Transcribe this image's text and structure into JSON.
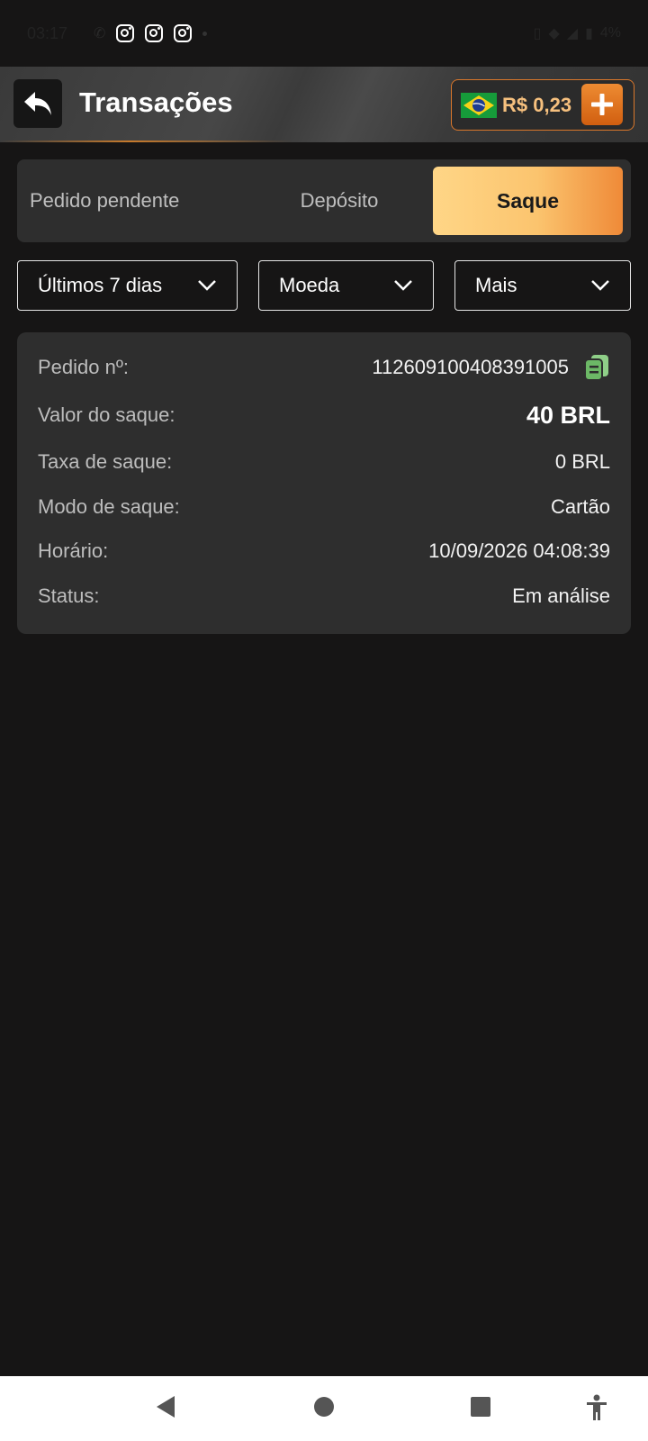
{
  "status_bar": {
    "time": "03:17",
    "battery": "4%"
  },
  "header": {
    "title": "Transações",
    "balance": "R$ 0,23"
  },
  "tabs": [
    {
      "label": "Pedido pendente",
      "active": false
    },
    {
      "label": "Depósito",
      "active": false
    },
    {
      "label": "Saque",
      "active": true
    }
  ],
  "filters": {
    "period": "Últimos 7 dias",
    "currency": "Moeda",
    "more": "Mais"
  },
  "transaction": {
    "order_label": "Pedido nº:",
    "order_value": "112609100408391005",
    "amount_label": "Valor do saque:",
    "amount_value": "40 BRL",
    "fee_label": "Taxa de saque:",
    "fee_value": "0 BRL",
    "mode_label": "Modo de saque:",
    "mode_value": "Cartão",
    "time_label": "Horário:",
    "time_value": "10/09/2026 04:08:39",
    "status_label": "Status:",
    "status_value": "Em análise"
  },
  "colors": {
    "accent": "#ef8a38",
    "active_tab_start": "#ffd687",
    "balance_text": "#f6c07e",
    "copy_icon": "#7fbf7a"
  }
}
